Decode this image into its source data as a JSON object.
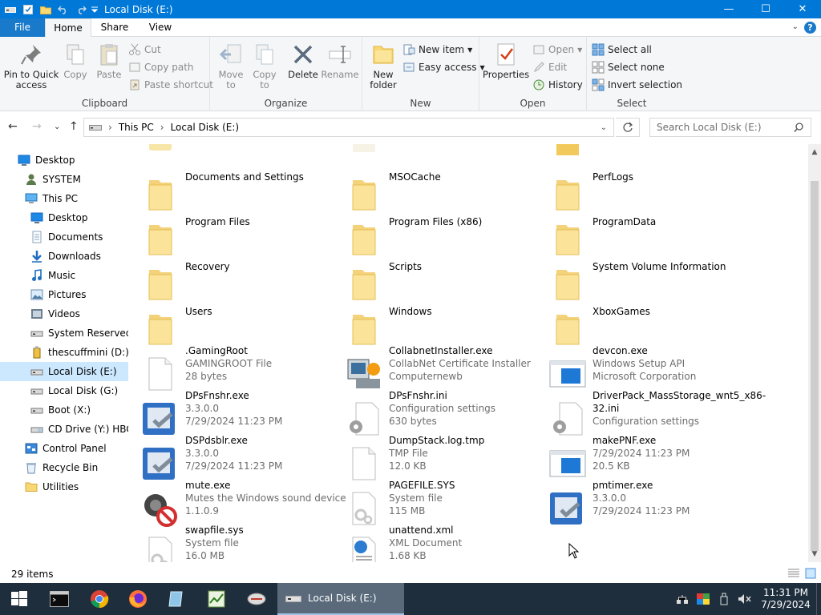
{
  "window": {
    "title": "Local Disk (E:)",
    "accent": "#0078d7",
    "controls": {
      "minimize": "—",
      "maximize": "☐",
      "close": "✕"
    }
  },
  "ribbon_tabs": [
    "File",
    "Home",
    "Share",
    "View"
  ],
  "ribbon": {
    "clipboard": {
      "label": "Clipboard",
      "pin": "Pin to Quick access",
      "copy": "Copy",
      "paste": "Paste",
      "cut": "Cut",
      "copy_path": "Copy path",
      "paste_shortcut": "Paste shortcut"
    },
    "organize": {
      "label": "Organize",
      "move_to": "Move to",
      "copy_to": "Copy to",
      "delete": "Delete",
      "rename": "Rename"
    },
    "new": {
      "label": "New",
      "new_folder": "New folder",
      "new_item": "New item",
      "easy_access": "Easy access"
    },
    "open": {
      "label": "Open",
      "properties": "Properties",
      "open": "Open",
      "edit": "Edit",
      "history": "History"
    },
    "select": {
      "label": "Select",
      "select_all": "Select all",
      "select_none": "Select none",
      "invert": "Invert selection"
    }
  },
  "address": {
    "crumbs": [
      "This PC",
      "Local Disk (E:)"
    ],
    "search_placeholder": "Search Local Disk (E:)"
  },
  "nav": [
    {
      "label": "Desktop",
      "icon": "desktop-icon",
      "indent": 0
    },
    {
      "label": "SYSTEM",
      "icon": "user-icon",
      "indent": 1
    },
    {
      "label": "This PC",
      "icon": "pc-icon",
      "indent": 1
    },
    {
      "label": "Desktop",
      "icon": "desktop-icon",
      "indent": 2
    },
    {
      "label": "Documents",
      "icon": "documents-icon",
      "indent": 2
    },
    {
      "label": "Downloads",
      "icon": "downloads-icon",
      "indent": 2
    },
    {
      "label": "Music",
      "icon": "music-icon",
      "indent": 2
    },
    {
      "label": "Pictures",
      "icon": "pictures-icon",
      "indent": 2
    },
    {
      "label": "Videos",
      "icon": "videos-icon",
      "indent": 2
    },
    {
      "label": "System Reserved (",
      "icon": "drive-icon",
      "indent": 2
    },
    {
      "label": "thescuffmini (D:)",
      "icon": "usb-icon",
      "indent": 2
    },
    {
      "label": "Local Disk (E:)",
      "icon": "drive-icon",
      "indent": 2,
      "selected": true
    },
    {
      "label": "Local Disk (G:)",
      "icon": "drive-icon",
      "indent": 2
    },
    {
      "label": "Boot (X:)",
      "icon": "drive-icon",
      "indent": 2
    },
    {
      "label": "CD Drive (Y:) HBC",
      "icon": "cd-icon",
      "indent": 2
    },
    {
      "label": "Control Panel",
      "icon": "control-panel-icon",
      "indent": 1
    },
    {
      "label": "Recycle Bin",
      "icon": "recycle-bin-icon",
      "indent": 1
    },
    {
      "label": "Utilities",
      "icon": "folder-icon",
      "indent": 1
    }
  ],
  "files": [
    {
      "name": "Documents and Settings",
      "lines": [],
      "icon": "folder-icon"
    },
    {
      "name": "MSOCache",
      "lines": [],
      "icon": "folder-icon"
    },
    {
      "name": "PerfLogs",
      "lines": [],
      "icon": "folder-icon"
    },
    {
      "name": "Program Files",
      "lines": [],
      "icon": "folder-icon"
    },
    {
      "name": "Program Files (x86)",
      "lines": [],
      "icon": "folder-icon"
    },
    {
      "name": "ProgramData",
      "lines": [],
      "icon": "folder-icon"
    },
    {
      "name": "Recovery",
      "lines": [],
      "icon": "folder-icon"
    },
    {
      "name": "Scripts",
      "lines": [],
      "icon": "folder-icon"
    },
    {
      "name": "System Volume Information",
      "lines": [],
      "icon": "folder-icon"
    },
    {
      "name": "Users",
      "lines": [],
      "icon": "folder-icon"
    },
    {
      "name": "Windows",
      "lines": [],
      "icon": "folder-icon"
    },
    {
      "name": "XboxGames",
      "lines": [],
      "icon": "folder-icon"
    },
    {
      "name": ".GamingRoot",
      "lines": [
        "GAMINGROOT File",
        "28 bytes"
      ],
      "icon": "file-icon"
    },
    {
      "name": "CollabnetInstaller.exe",
      "lines": [
        "CollabNet Certificate Installer",
        "Computernewb"
      ],
      "icon": "installer-icon"
    },
    {
      "name": "devcon.exe",
      "lines": [
        "Windows Setup API",
        "Microsoft Corporation"
      ],
      "icon": "app-window-icon"
    },
    {
      "name": "DPsFnshr.exe",
      "lines": [
        "3.3.0.0",
        "7/29/2024 11:23 PM"
      ],
      "icon": "exe-icon"
    },
    {
      "name": "DPsFnshr.ini",
      "lines": [
        "Configuration settings",
        "630 bytes"
      ],
      "icon": "config-icon"
    },
    {
      "name": "DriverPack_MassStorage_wnt5_x86-32.ini",
      "lines": [
        "Configuration settings"
      ],
      "icon": "config-icon"
    },
    {
      "name": "DSPdsblr.exe",
      "lines": [
        "3.3.0.0",
        "7/29/2024 11:23 PM"
      ],
      "icon": "exe-icon"
    },
    {
      "name": "DumpStack.log.tmp",
      "lines": [
        "TMP File",
        "12.0 KB"
      ],
      "icon": "file-icon"
    },
    {
      "name": "makePNF.exe",
      "lines": [
        "7/29/2024 11:23 PM",
        "20.5 KB"
      ],
      "icon": "app-window-icon"
    },
    {
      "name": "mute.exe",
      "lines": [
        "Mutes the Windows sound device",
        "1.1.0.9"
      ],
      "icon": "mute-icon"
    },
    {
      "name": "PAGEFILE.SYS",
      "lines": [
        "System file",
        "115 MB"
      ],
      "icon": "system-file-icon"
    },
    {
      "name": "pmtimer.exe",
      "lines": [
        "3.3.0.0",
        "7/29/2024 11:23 PM"
      ],
      "icon": "exe-icon"
    },
    {
      "name": "swapfile.sys",
      "lines": [
        "System file",
        "16.0 MB"
      ],
      "icon": "system-file-icon"
    },
    {
      "name": "unattend.xml",
      "lines": [
        "XML Document",
        "1.68 KB"
      ],
      "icon": "xml-icon"
    }
  ],
  "status": {
    "count": "29 items"
  },
  "taskbar": {
    "active_label": "Local Disk (E:)",
    "time": "11:31 PM",
    "date": "7/29/2024"
  }
}
